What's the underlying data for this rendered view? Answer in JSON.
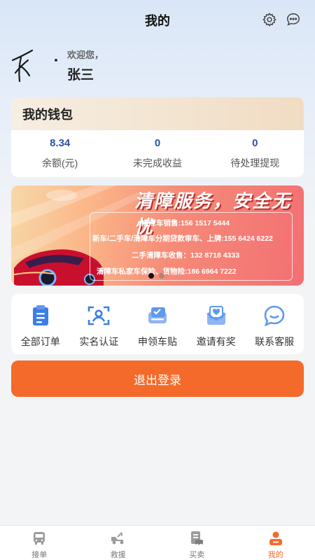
{
  "header": {
    "title": "我的"
  },
  "profile": {
    "welcome": "欢迎您，",
    "name": "张三"
  },
  "wallet": {
    "title": "我的钱包",
    "stats": [
      {
        "value": "8.34",
        "label": "余额(元)"
      },
      {
        "value": "0",
        "label": "未完成收益"
      },
      {
        "value": "0",
        "label": "待处理提现"
      }
    ]
  },
  "banner": {
    "title": "清障服务，安全无忧",
    "lines": [
      "清障车销售:156 1517 5444",
      "新车/二手车/清障车分期贷款审车、上牌:155 6424 6222",
      "二手清障车收售：132 8718 4333",
      "清障车私家车保险、货物险:186 6964 7222"
    ],
    "active_slide": 1,
    "slide_count": 2
  },
  "menu": [
    {
      "label": "全部订单",
      "icon": "clipboard-icon"
    },
    {
      "label": "实名认证",
      "icon": "face-scan-icon"
    },
    {
      "label": "申领车贴",
      "icon": "sticker-icon"
    },
    {
      "label": "邀请有奖",
      "icon": "gift-envelope-icon"
    },
    {
      "label": "联系客服",
      "icon": "chat-bubble-icon"
    }
  ],
  "logout_label": "退出登录",
  "tabbar": [
    {
      "label": "接单",
      "icon": "bus-icon"
    },
    {
      "label": "救援",
      "icon": "tow-truck-icon"
    },
    {
      "label": "买卖",
      "icon": "document-car-icon"
    },
    {
      "label": "我的",
      "icon": "user-icon",
      "active": true
    }
  ],
  "colors": {
    "accent": "#f46a2b",
    "stat_value": "#2a4fa8",
    "icon_blue": "#3c7ee6",
    "wallet_header": "#f1dcc3"
  }
}
